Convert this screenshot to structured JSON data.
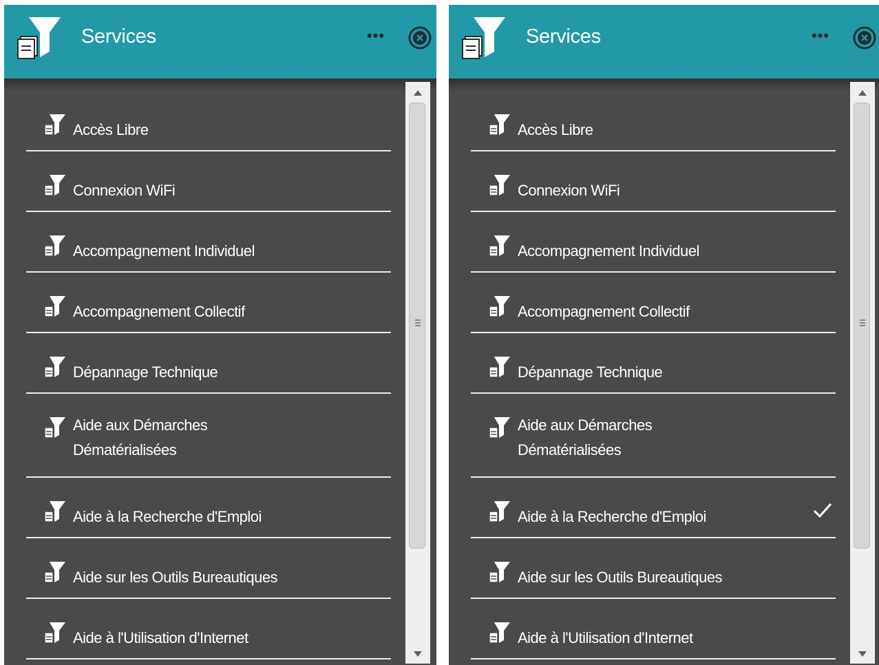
{
  "panels": [
    {
      "header": {
        "title": "Services",
        "more_label": "•••"
      },
      "items": [
        {
          "label": "Accès Libre",
          "checked": false
        },
        {
          "label": "Connexion WiFi",
          "checked": false
        },
        {
          "label": "Accompagnement Individuel",
          "checked": false
        },
        {
          "label": "Accompagnement Collectif",
          "checked": false
        },
        {
          "label": "Dépannage Technique",
          "checked": false
        },
        {
          "label": "Aide aux Démarches Dématérialisées",
          "checked": false
        },
        {
          "label": "Aide à la Recherche d'Emploi",
          "checked": false
        },
        {
          "label": "Aide sur les Outils Bureautiques",
          "checked": false
        },
        {
          "label": "Aide à l'Utilisation d'Internet",
          "checked": false
        }
      ]
    },
    {
      "header": {
        "title": "Services",
        "more_label": "•••"
      },
      "items": [
        {
          "label": "Accès Libre",
          "checked": false
        },
        {
          "label": "Connexion WiFi",
          "checked": false
        },
        {
          "label": "Accompagnement Individuel",
          "checked": false
        },
        {
          "label": "Accompagnement Collectif",
          "checked": false
        },
        {
          "label": "Dépannage Technique",
          "checked": false
        },
        {
          "label": "Aide aux Démarches Dématérialisées",
          "checked": false
        },
        {
          "label": "Aide à la Recherche d'Emploi",
          "checked": true
        },
        {
          "label": "Aide sur les Outils Bureautiques",
          "checked": false
        },
        {
          "label": "Aide à l'Utilisation d'Internet",
          "checked": false
        }
      ]
    }
  ],
  "colors": {
    "header": "#2399a8",
    "panel": "#4a4a4a",
    "divider": "#ececec",
    "text": "#ffffff"
  },
  "icons": {
    "logo": "funnel-document-icon",
    "item": "funnel-document-icon",
    "more": "ellipsis-icon",
    "close": "close-circle-icon",
    "check": "checkmark-icon"
  }
}
